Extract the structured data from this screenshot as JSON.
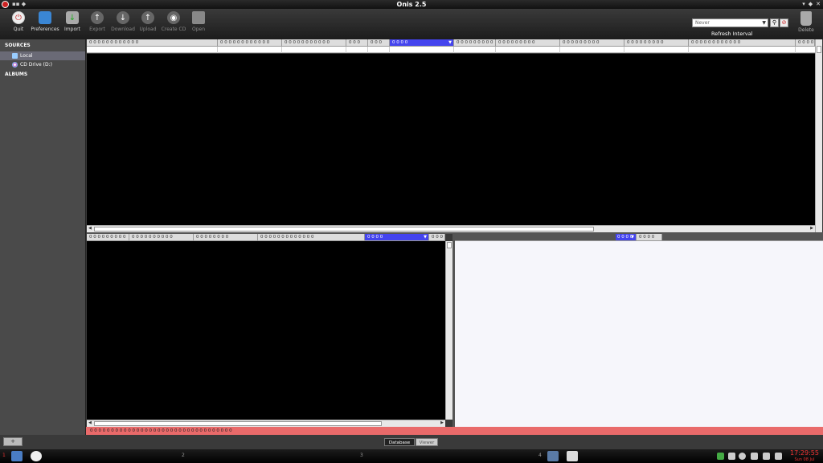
{
  "window": {
    "title": "Onis 2.5"
  },
  "toolbar": {
    "quit": "Quit",
    "preferences": "Preferences",
    "import": "Import",
    "export": "Export",
    "download": "Download",
    "upload": "Upload",
    "create_cd": "Create CD",
    "open": "Open",
    "refresh_value": "Never",
    "refresh_label": "Refresh Interval",
    "delete": "Delete"
  },
  "sidebar": {
    "sources_title": "SOURCES",
    "items": [
      {
        "label": "Local",
        "selected": true
      },
      {
        "label": "CD Drive (D:)",
        "selected": false
      }
    ],
    "albums_title": "ALBUMS"
  },
  "top_grid": {
    "columns": [
      "0 0 0 0 0 0 0 0 0 0 0 0",
      "0 0 0 0 0 0 0 0 0 0 0 0",
      "0 0 0 0 0 0 0 0 0 0 0",
      "0 0 0",
      "0 0 0",
      "0 0 0 0",
      "0 0 0 0 0 0 0 0 0",
      "0 0 0 0 0 0 0 0 0",
      "0 0 0 0 0 0 0 0 0",
      "0 0 0 0 0 0 0 0 0",
      "0 0 0 0 0 0 0 0 0 0 0 0",
      "0 0 0 0"
    ]
  },
  "bottom_left_grid": {
    "columns": [
      "0 0 0 0 0 0 0 0 0",
      "0 0 0 0 0 0 0 0 0 0",
      "0 0 0 0 0 0 0 0",
      "0 0 0 0 0 0 0 0 0 0 0 0 0",
      "0 0 0 0",
      "0 0 0"
    ]
  },
  "bottom_right_grid": {
    "columns": [
      "0 0 0 0",
      "0 0 0 0"
    ]
  },
  "status": {
    "text": "0 0 0 0 0 0 0 0 0 0 0 0 0 0 0 0 0 0 0 0 0 0 0 0 0 0 0 0 0 0 0 0 0 0"
  },
  "bottom": {
    "add_label": "+",
    "tab_database": "Database",
    "tab_viewer": "Viewer"
  },
  "taskbar": {
    "workspaces": [
      "1",
      "2",
      "3",
      "4"
    ],
    "time": "17:29:55",
    "date": "Sun 08 Jul"
  },
  "colors": {
    "accent": "#4444ee",
    "status": "#e96a6a"
  }
}
